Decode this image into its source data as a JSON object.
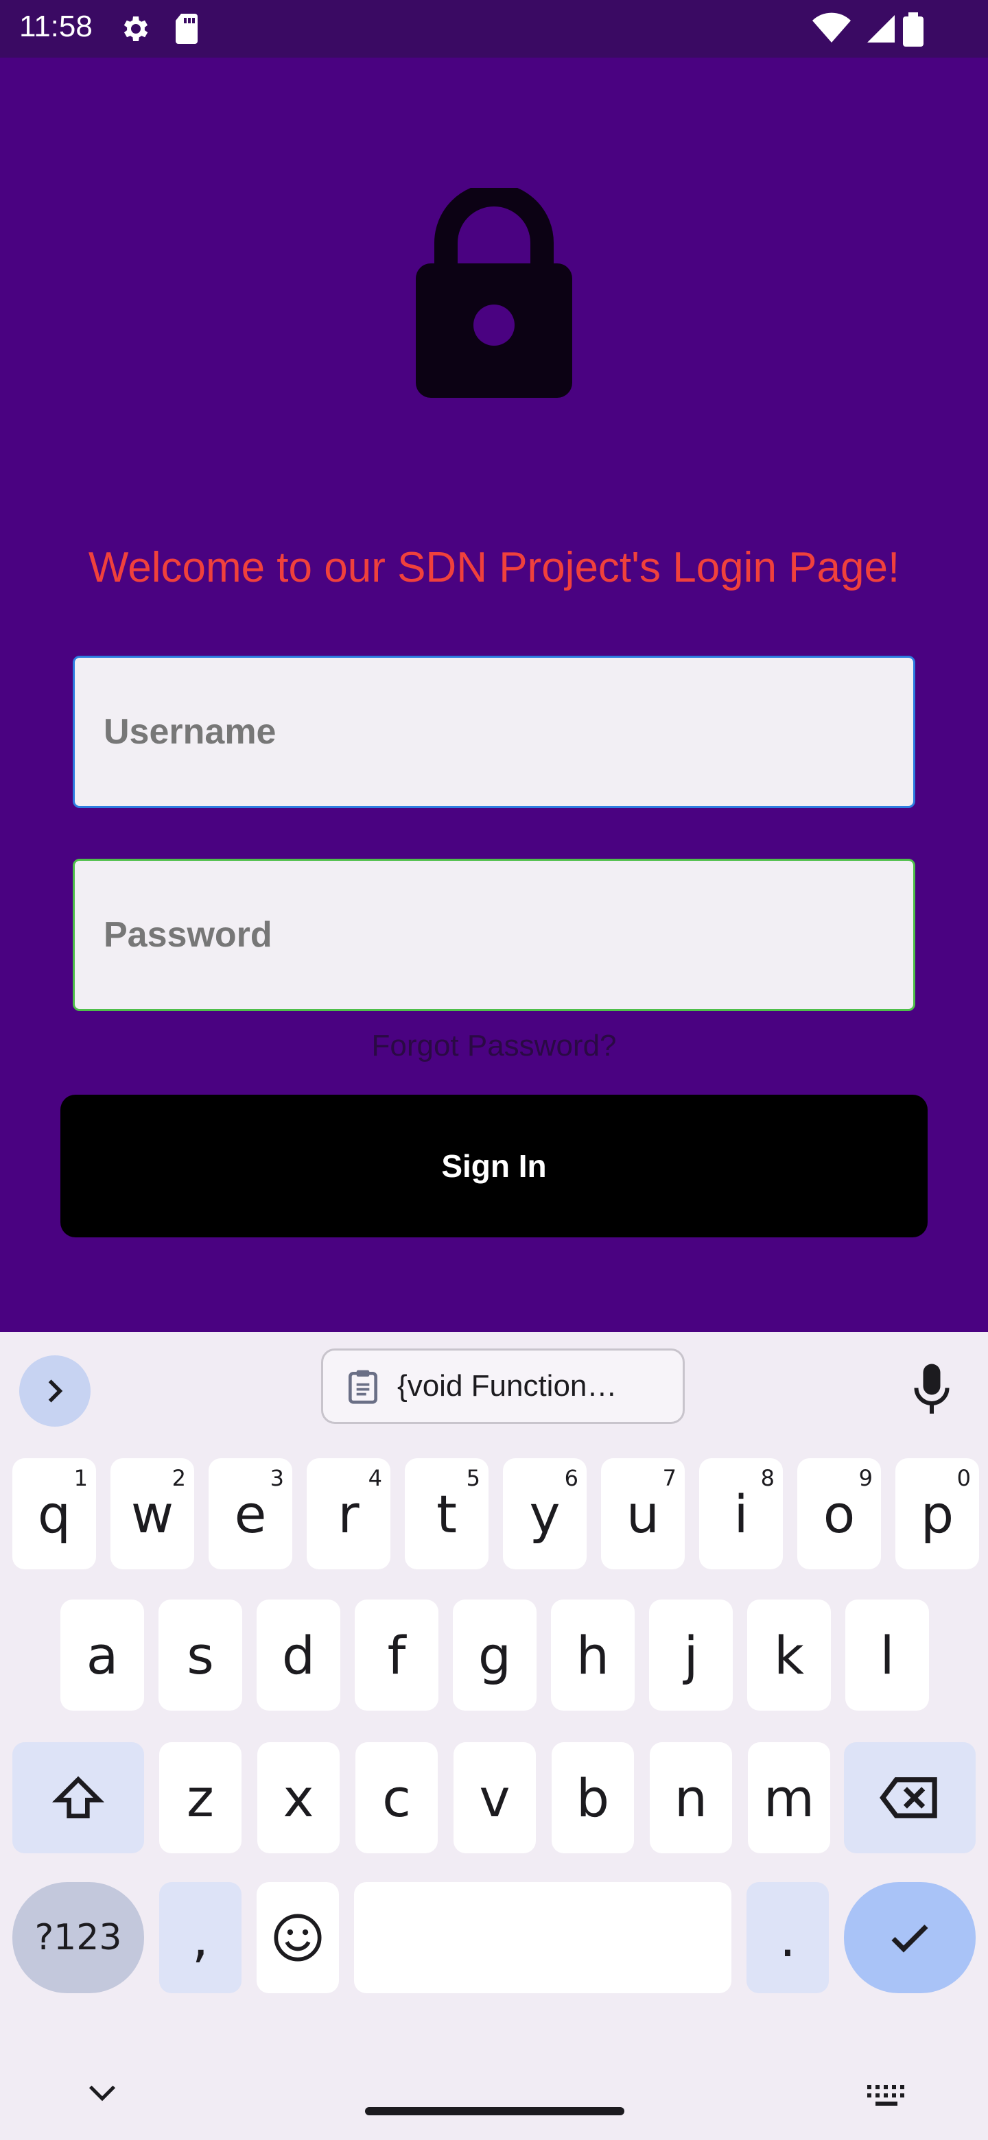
{
  "status_bar": {
    "time": "11:58"
  },
  "app": {
    "welcome_text": "Welcome to our SDN Project's Login Page!",
    "username": {
      "placeholder": "Username",
      "value": ""
    },
    "password": {
      "placeholder": "Password",
      "value": ""
    },
    "forgot_password": "Forgot Password?",
    "sign_in": "Sign In"
  },
  "colors": {
    "background": "#4a0281",
    "welcome_text": "#f0413c",
    "username_border": "#2d7de0",
    "password_border": "#4fbf4a",
    "sign_in_bg": "#000000"
  },
  "keyboard": {
    "clipboard_suggestion": "{void Function…",
    "row1": [
      {
        "k": "q",
        "n": "1"
      },
      {
        "k": "w",
        "n": "2"
      },
      {
        "k": "e",
        "n": "3"
      },
      {
        "k": "r",
        "n": "4"
      },
      {
        "k": "t",
        "n": "5"
      },
      {
        "k": "y",
        "n": "6"
      },
      {
        "k": "u",
        "n": "7"
      },
      {
        "k": "i",
        "n": "8"
      },
      {
        "k": "o",
        "n": "9"
      },
      {
        "k": "p",
        "n": "0"
      }
    ],
    "row2": [
      "a",
      "s",
      "d",
      "f",
      "g",
      "h",
      "j",
      "k",
      "l"
    ],
    "row3": [
      "z",
      "x",
      "c",
      "v",
      "b",
      "n",
      "m"
    ],
    "symbols_key": "?123",
    "comma_key": ",",
    "period_key": "."
  }
}
